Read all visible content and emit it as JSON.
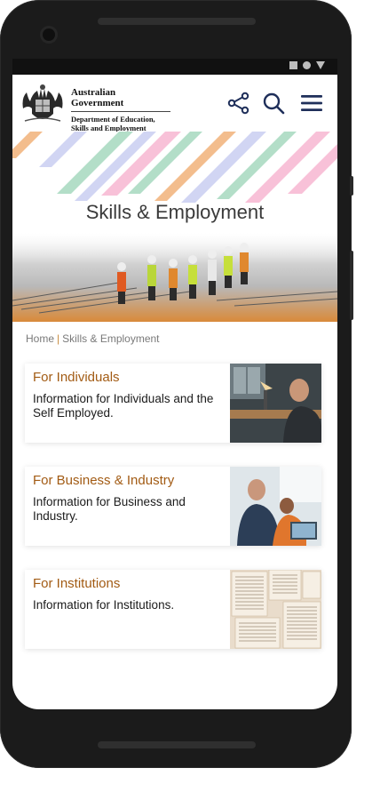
{
  "header": {
    "gov_main": "Australian Government",
    "gov_sub_line1": "Department of Education,",
    "gov_sub_line2": "Skills and Employment",
    "icons": [
      "share-icon",
      "search-icon",
      "menu-icon"
    ]
  },
  "banner": {
    "title": "Skills & Employment"
  },
  "breadcrumb": {
    "home": "Home",
    "separator": "|",
    "current": "Skills & Employment"
  },
  "cards": [
    {
      "title": "For Individuals",
      "text": "Information for Individuals and the Self Employed."
    },
    {
      "title": "For Business & Industry",
      "text": "Information for Business and Industry."
    },
    {
      "title": "For Institutions",
      "text": "Information for Institutions."
    }
  ],
  "colors": {
    "accent": "#a25b14",
    "breadcrumb_sep": "#c98a3e",
    "brand_blue": "#1f2f5a"
  }
}
